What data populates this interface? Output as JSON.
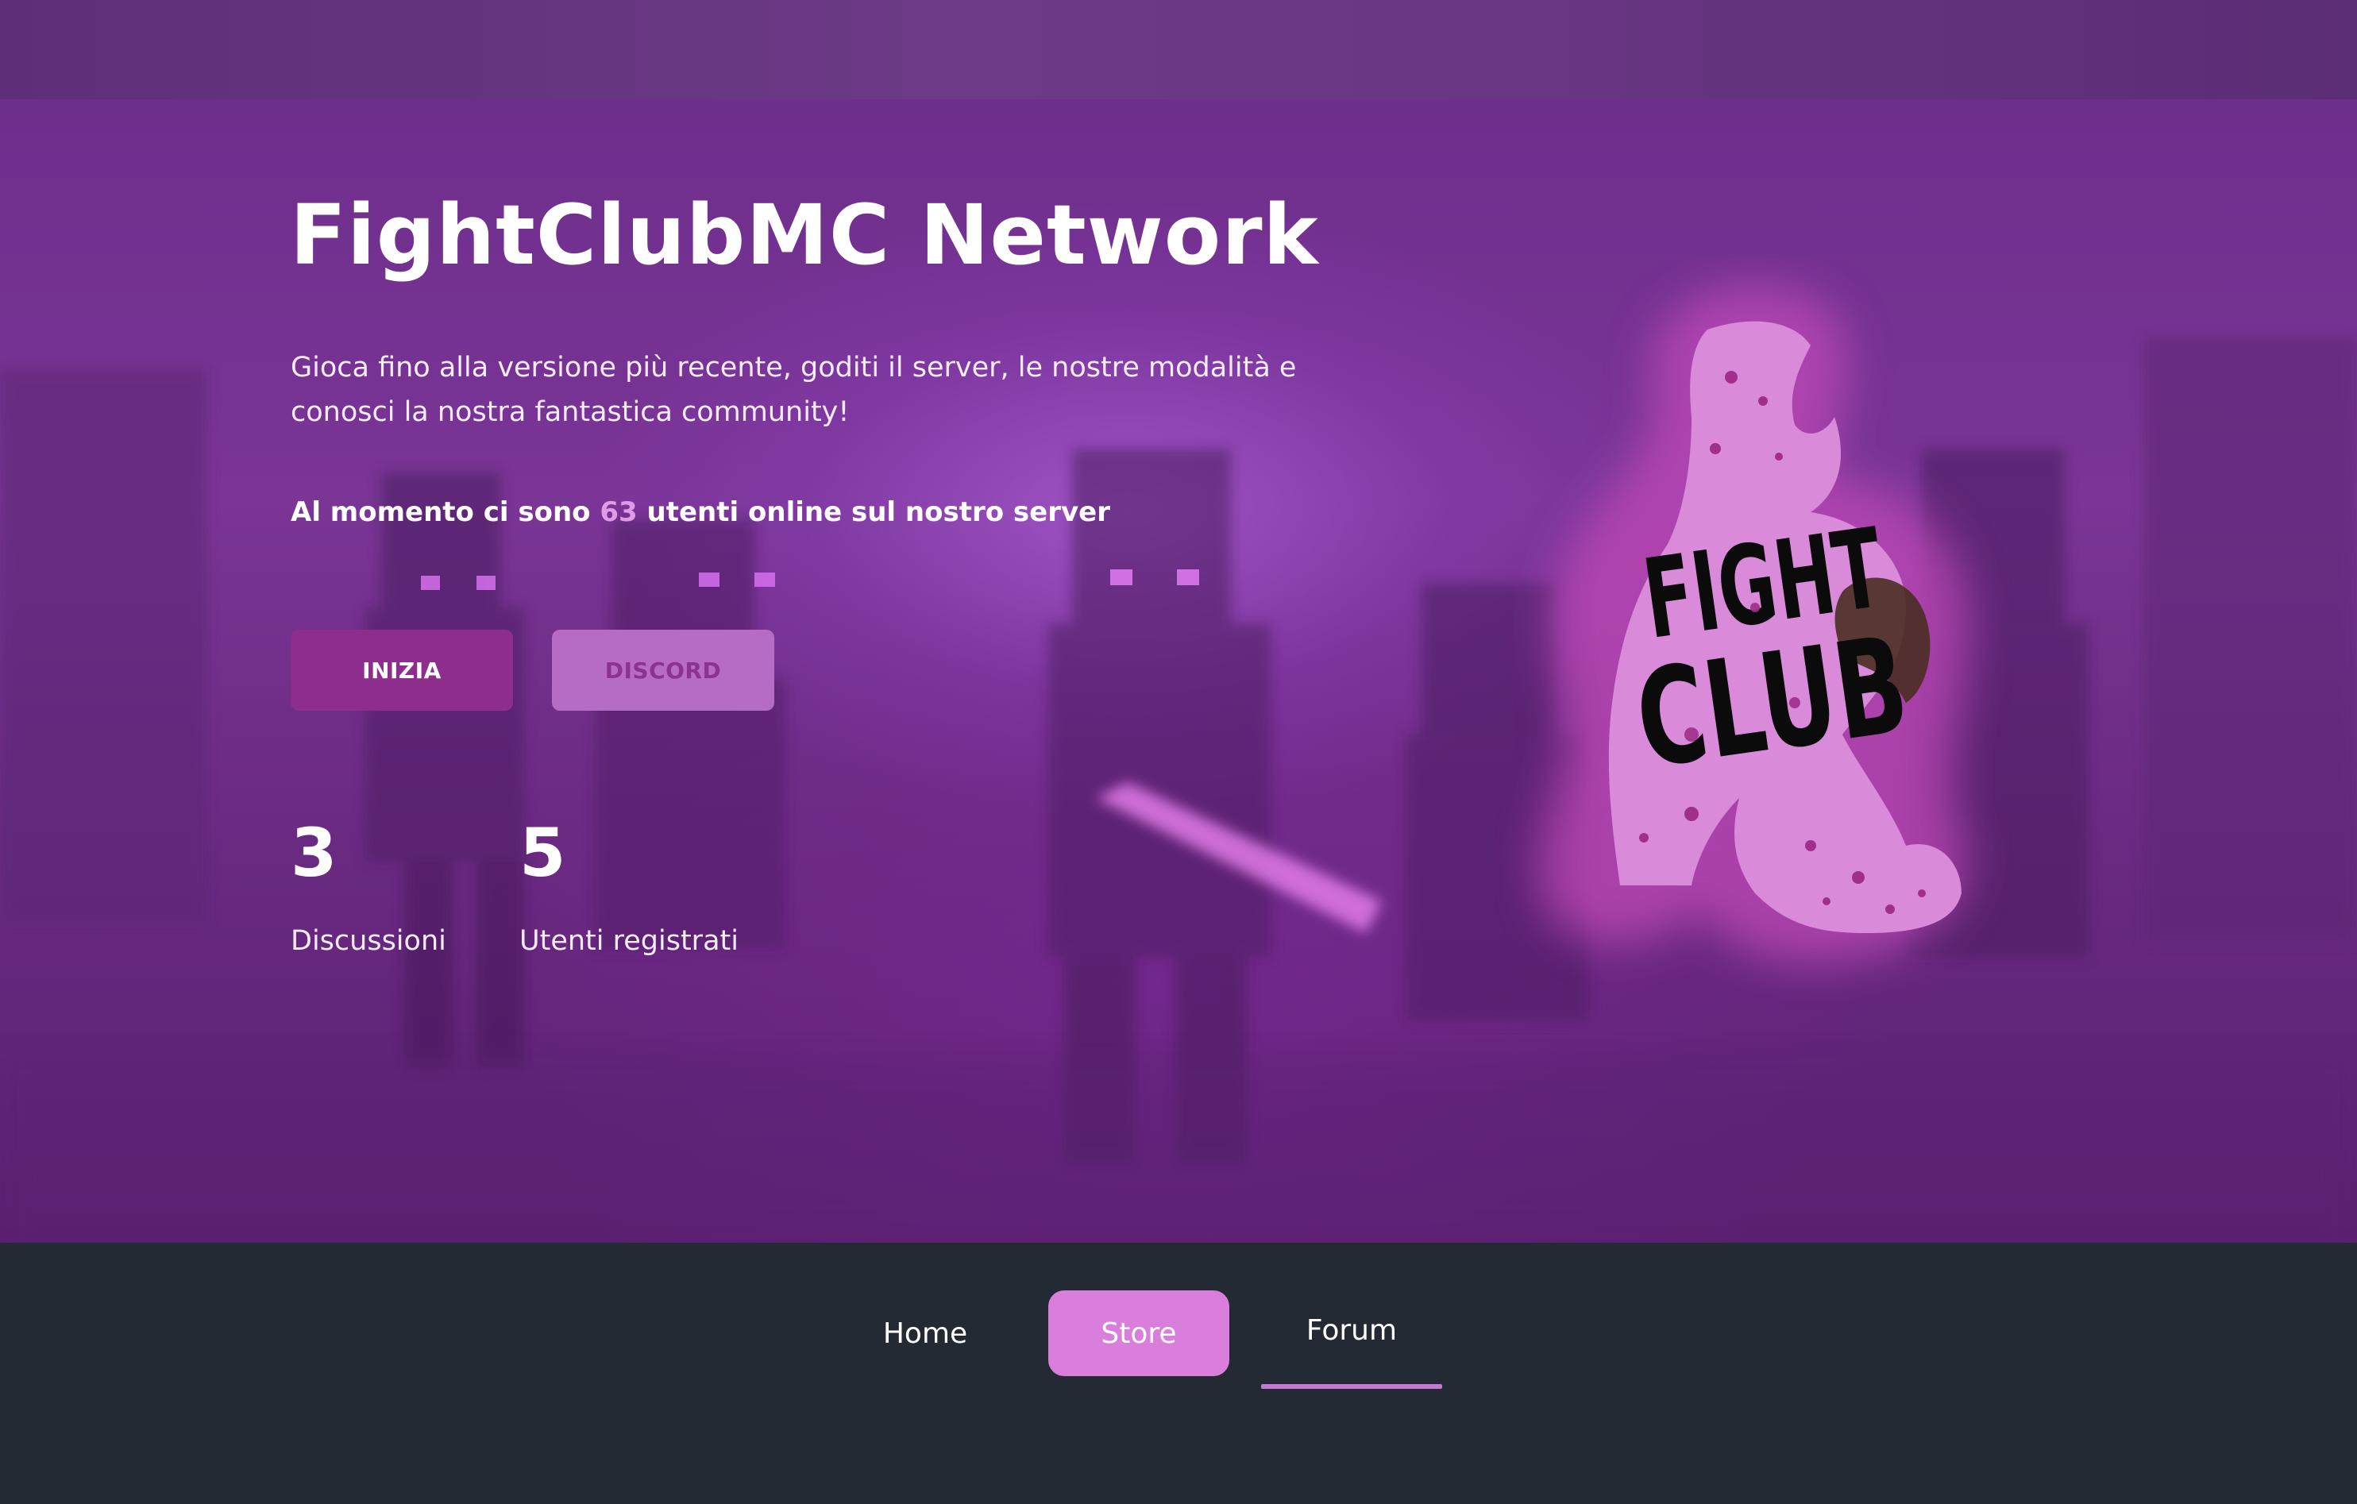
{
  "hero": {
    "title": "FightClubMC Network",
    "description": "Gioca fino alla versione più recente, goditi il server, le nostre modalità e conosci la nostra fantastica community!",
    "online_prefix": "Al momento ci sono ",
    "online_count": "63",
    "online_suffix": " utenti online sul nostro server",
    "buttons": {
      "start_label": "INIZIA",
      "discord_label": "DISCORD"
    },
    "stats": [
      {
        "value": "3",
        "label": "Discussioni"
      },
      {
        "value": "5",
        "label": "Utenti registrati"
      }
    ],
    "logo": {
      "text_line1": "FIGHT",
      "text_line2": "CLUB"
    }
  },
  "nav": {
    "items": [
      {
        "label": "Home"
      },
      {
        "label": "Store"
      },
      {
        "label": "Forum"
      }
    ]
  },
  "colors": {
    "hero_purple": "#7a3596",
    "accent_pink": "#d97fdb",
    "online_count": "#e09be6",
    "button_start": "#8e2e8c",
    "button_discord": "#b66cc4",
    "navbar_bg": "#232a34"
  },
  "icons": {
    "logo": "fightclub-logo-icon"
  }
}
